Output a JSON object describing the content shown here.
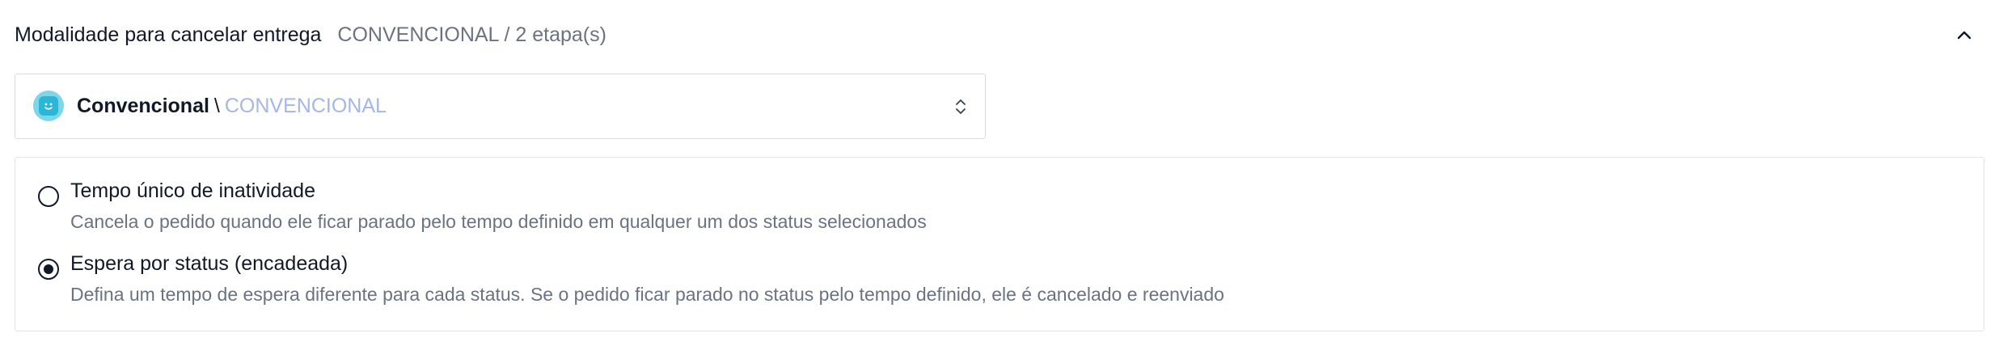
{
  "section": {
    "title": "Modalidade para cancelar entrega",
    "subtitle": "CONVENCIONAL / 2 etapa(s)",
    "toggle_icon": "chevron-up-icon"
  },
  "select": {
    "main": "Convencional",
    "separator": "\\",
    "secondary": "CONVENCIONAL",
    "avatar_icon": "bot-avatar-icon",
    "chevrons_icon": "chevron-up-down-icon",
    "avatar_color": "#2bb8d6",
    "secondary_color": "#a5b6e8"
  },
  "options": [
    {
      "label": "Tempo único de inatividade",
      "description": "Cancela o pedido quando ele ficar parado pelo tempo definido em qualquer um dos status selecionados",
      "selected": false
    },
    {
      "label": "Espera por status (encadeada)",
      "description": "Defina um tempo de espera diferente para cada status. Se o pedido ficar parado no status pelo tempo definido, ele é cancelado e reenviado",
      "selected": true
    }
  ]
}
